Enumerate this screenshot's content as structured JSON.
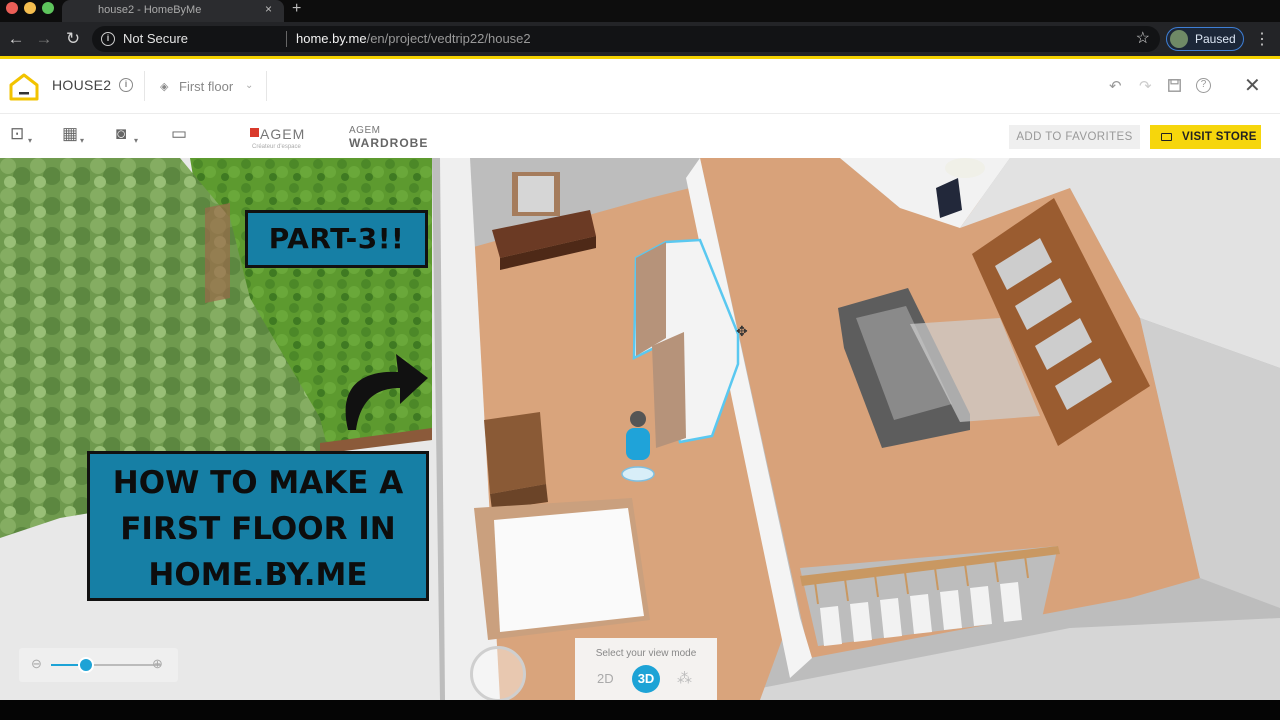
{
  "browser": {
    "tab_title": "house2 - HomeByMe",
    "tab_close": "×",
    "new_tab": "+",
    "security_text": "Not Secure",
    "url_domain": "home.by.me",
    "url_path": "/en/project/vedtrip22/house2",
    "profile_status": "Paused"
  },
  "app": {
    "project_name": "HOUSE2",
    "floor_label": "First floor",
    "add_favorites": "ADD TO FAVORITES",
    "visit_store": "VISIT STORE",
    "brand_agem": "AGEM",
    "brand_agem_sub": "Créateur d'espace",
    "brand_wardrobe_1": "AGEM",
    "brand_wardrobe_2": "WARDROBE"
  },
  "overlay": {
    "part": "PART-3!!",
    "title_line1": "HOW TO MAKE A",
    "title_line2": "FIRST FLOOR IN",
    "title_line3": "HOME.BY.ME"
  },
  "view_mode": {
    "label": "Select your view mode",
    "mode_2d": "2D",
    "mode_3d": "3D",
    "active": "3D"
  },
  "zoom": {
    "level": 0.32
  },
  "colors": {
    "accent_yellow": "#f6d60c",
    "brand_blue": "#1da3d6",
    "overlay_blue": "#167fa5",
    "wood_floor": "#d9a47c"
  },
  "icons": {
    "back": "arrow-left-icon",
    "forward": "arrow-right-icon",
    "reload": "reload-icon",
    "bookmark": "star-icon",
    "undo": "undo-icon",
    "redo": "redo-icon",
    "save": "save-icon",
    "help": "help-icon",
    "close": "close-icon"
  }
}
